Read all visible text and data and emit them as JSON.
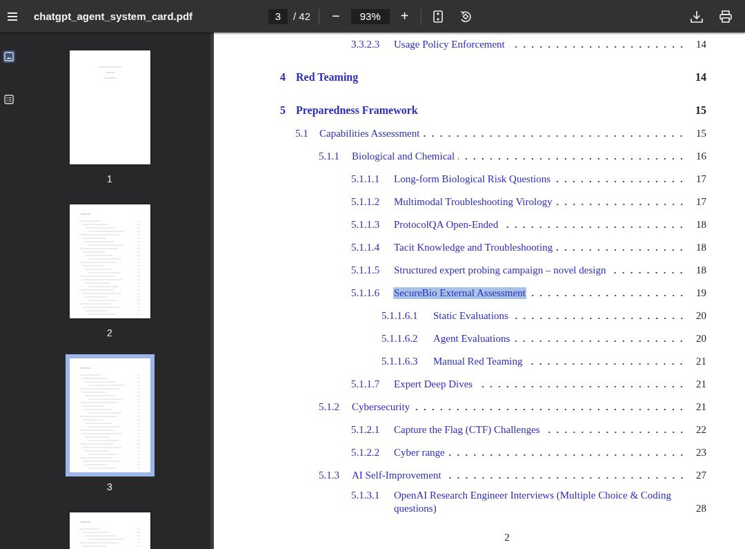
{
  "toolbar": {
    "file_name": "chatgpt_agent_system_card.pdf",
    "page_number": "3",
    "page_count": "/ 42",
    "zoom_out": "−",
    "zoom": "93%",
    "zoom_in": "+"
  },
  "sidebar": {
    "views": [
      {
        "kind": "thumbnails",
        "selected": true
      },
      {
        "kind": "outline",
        "selected": false
      }
    ],
    "thumbnails": [
      {
        "kind": "title",
        "label": "1",
        "selected": false
      },
      {
        "kind": "contents",
        "label": "2",
        "selected": false
      },
      {
        "kind": "contents",
        "label": "3",
        "selected": true
      },
      {
        "kind": "contents",
        "selected": false
      }
    ]
  },
  "toc": {
    "continued": [
      {
        "number": "3.3.2.3",
        "title": "Usage Policy Enforcement",
        "page": "14",
        "highlighted": false
      }
    ],
    "entries": [
      {
        "number": "4",
        "title": "Red Teaming",
        "page": "14",
        "highlighted": false
      },
      {
        "number": "5",
        "title": "Preparedness Framework",
        "page": "15",
        "highlighted": false,
        "children": [
          {
            "number": "5.1",
            "title": "Capabilities Assessment",
            "page": "15",
            "highlighted": false,
            "children": [
              {
                "number": "5.1.1",
                "title": "Biological and Chemical",
                "page": "16",
                "highlighted": false,
                "children": [
                  {
                    "number": "5.1.1.1",
                    "title": "Long-form Biological Risk Questions",
                    "page": "17",
                    "highlighted": false
                  },
                  {
                    "number": "5.1.1.2",
                    "title": "Multimodal Troubleshooting Virology",
                    "page": "17",
                    "highlighted": false
                  },
                  {
                    "number": "5.1.1.3",
                    "title": "ProtocolQA Open-Ended",
                    "page": "18",
                    "highlighted": false
                  },
                  {
                    "number": "5.1.1.4",
                    "title": "Tacit Knowledge and Troubleshooting",
                    "page": "18",
                    "highlighted": false
                  },
                  {
                    "number": "5.1.1.5",
                    "title": "Structured expert probing campaign – novel design",
                    "page": "18",
                    "highlighted": false
                  },
                  {
                    "number": "5.1.1.6",
                    "title": "SecureBio External Assessment",
                    "page": "19",
                    "highlighted": true,
                    "children": [
                      {
                        "number": "5.1.1.6.1",
                        "title": "Static Evaluations",
                        "page": "20",
                        "highlighted": false
                      },
                      {
                        "number": "5.1.1.6.2",
                        "title": "Agent Evaluations",
                        "page": "20",
                        "highlighted": false
                      },
                      {
                        "number": "5.1.1.6.3",
                        "title": "Manual Red Teaming",
                        "page": "21",
                        "highlighted": false
                      }
                    ]
                  },
                  {
                    "number": "5.1.1.7",
                    "title": "Expert Deep Dives",
                    "page": "21",
                    "highlighted": false
                  }
                ]
              },
              {
                "number": "5.1.2",
                "title": "Cybersecurity",
                "page": "21",
                "highlighted": false,
                "children": [
                  {
                    "number": "5.1.2.1",
                    "title": "Capture the Flag (CTF) Challenges",
                    "page": "22",
                    "highlighted": false
                  },
                  {
                    "number": "5.1.2.2",
                    "title": "Cyber range",
                    "page": "23",
                    "highlighted": false
                  }
                ]
              },
              {
                "number": "5.1.3",
                "title": "AI Self-Improvement",
                "page": "27",
                "highlighted": false,
                "children": [
                  {
                    "number": "5.1.3.1",
                    "title": "OpenAI Research Engineer Interviews (Multiple Choice & Coding questions)",
                    "page": "28",
                    "highlighted": false
                  }
                ]
              }
            ]
          }
        ]
      }
    ]
  },
  "footer_page": "2"
}
